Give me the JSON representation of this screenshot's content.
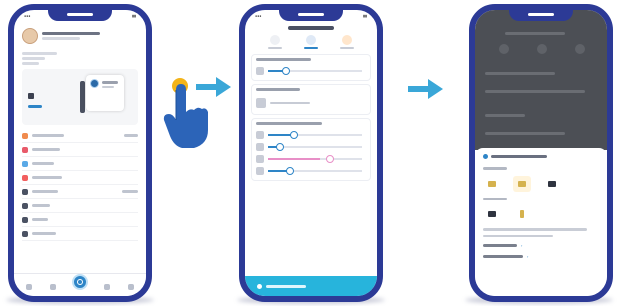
{
  "arrow_color": "#3aa7d8",
  "frame_color": "#2c3a96",
  "accent_color": "#2e85c7",
  "tap_dot_color": "#f3b41a",
  "icons": [
    "tap-hand-icon",
    "right-arrow-icon",
    "right-arrow-icon"
  ],
  "screens": [
    {
      "name": "home-profile-screen"
    },
    {
      "name": "device-settings-screen"
    },
    {
      "name": "mode-options-sheet-screen"
    }
  ]
}
